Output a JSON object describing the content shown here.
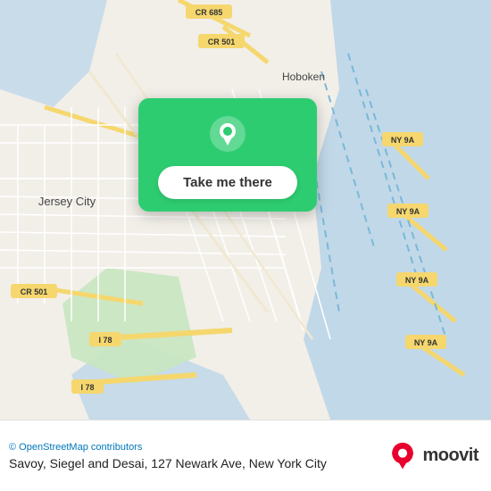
{
  "map": {
    "alt": "Map of Jersey City and Hoboken area, New York"
  },
  "card": {
    "button_label": "Take me there"
  },
  "footer": {
    "attribution": "© OpenStreetMap contributors",
    "location": "Savoy, Siegel and Desai, 127 Newark Ave, New York City"
  },
  "moovit": {
    "label": "moovit"
  },
  "colors": {
    "green": "#2ecc71",
    "moovit_red": "#e8002d",
    "moovit_orange": "#ff6600"
  }
}
